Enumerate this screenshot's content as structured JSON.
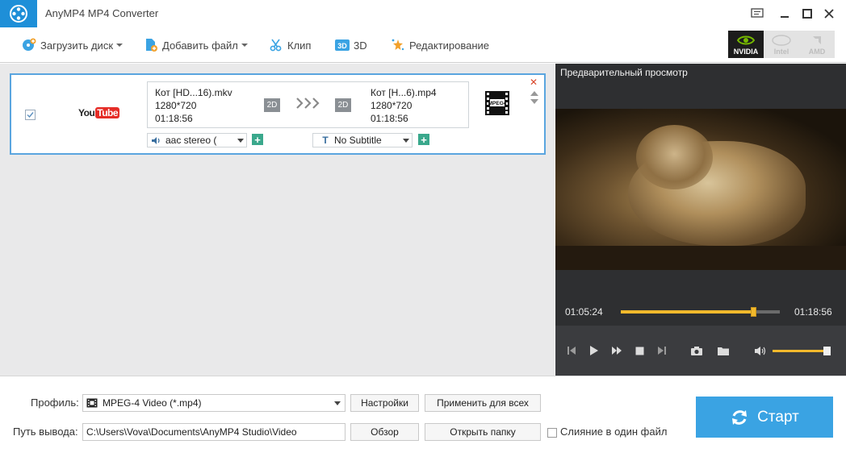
{
  "window": {
    "title": "AnyMP4 MP4 Converter"
  },
  "toolbar": {
    "load_disc": "Загрузить диск",
    "add_file": "Добавить файл",
    "clip": "Клип",
    "three_d": "3D",
    "edit": "Редактирование"
  },
  "gpu": {
    "nvidia": "NVIDIA",
    "intel": "Intel",
    "amd": "AMD"
  },
  "file_row": {
    "source": {
      "name": "Кот [HD...16).mkv",
      "resolution": "1280*720",
      "duration": "01:18:56",
      "mode": "2D"
    },
    "output": {
      "name": "Кот [H...6).mp4",
      "resolution": "1280*720",
      "duration": "01:18:56",
      "mode": "2D"
    },
    "audio_track": "aac stereo (",
    "subtitle": "No Subtitle",
    "format_icon_label": "MPEG4",
    "source_logo": {
      "you": "You",
      "tube": "Tube"
    }
  },
  "preview": {
    "title": "Предварительный просмотр",
    "current_time": "01:05:24",
    "total_time": "01:18:56",
    "progress_fraction": 0.83,
    "volume_fraction": 0.9
  },
  "bottom": {
    "profile_label": "Профиль:",
    "profile_value": "MPEG-4 Video (*.mp4)",
    "settings_button": "Настройки",
    "apply_all_button": "Применить для всех",
    "output_label": "Путь вывода:",
    "output_path": "C:\\Users\\Vova\\Documents\\AnyMP4 Studio\\Video",
    "browse_button": "Обзор",
    "open_folder_button": "Открыть папку",
    "merge_label": "Слияние в один файл",
    "start_button": "Старт"
  },
  "colors": {
    "accent": "#3aa3e3",
    "logo": "#1e8fd8",
    "progress": "#f2b92c",
    "plus": "#3aa88c"
  }
}
